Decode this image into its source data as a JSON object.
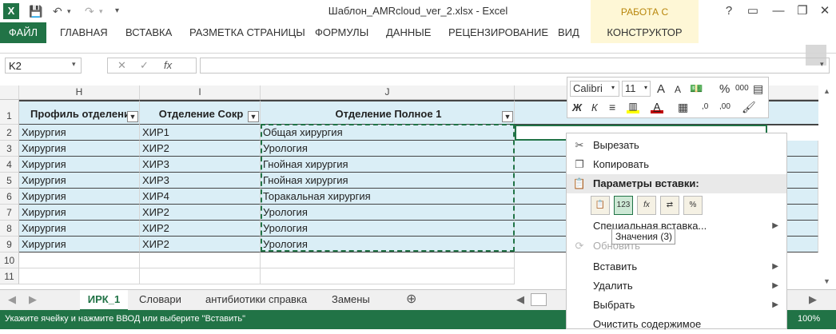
{
  "app": {
    "title": "Шаблон_AMRcloud_ver_2.xlsx - Excel",
    "context_tab_group": "РАБОТА С ТАБЛИЦАМИ",
    "accent": "#217346"
  },
  "window_buttons": [
    "?",
    "▭",
    "—",
    "❐",
    "✕"
  ],
  "ribbon_tabs": [
    "ФАЙЛ",
    "ГЛАВНАЯ",
    "ВСТАВКА",
    "РАЗМЕТКА СТРАНИЦЫ",
    "ФОРМУЛЫ",
    "ДАННЫЕ",
    "РЕЦЕНЗИРОВАНИЕ",
    "ВИД",
    "КОНСТРУКТОР"
  ],
  "formula_bar": {
    "name_box": "K2",
    "fx": "fx",
    "value": ""
  },
  "columns": [
    "H",
    "I",
    "J"
  ],
  "row_numbers": [
    "1",
    "2",
    "3",
    "4",
    "5",
    "6",
    "7",
    "8",
    "9",
    "10",
    "11"
  ],
  "table_headers": [
    "Профиль отделени",
    "Отделение Сокр",
    "Отделение Полное 1"
  ],
  "rows": [
    [
      "Хирургия",
      "ХИР1",
      "Общая хирургия"
    ],
    [
      "Хирургия",
      "ХИР2",
      "Урология"
    ],
    [
      "Хирургия",
      "ХИР3",
      "Гнойная хирургия"
    ],
    [
      "Хирургия",
      "ХИР3",
      "Гнойная хирургия"
    ],
    [
      "Хирургия",
      "ХИР4",
      "Торакальная хирургия"
    ],
    [
      "Хирургия",
      "ХИР2",
      "Урология"
    ],
    [
      "Хирургия",
      "ХИР2",
      "Урология"
    ],
    [
      "Хирургия",
      "ХИР2",
      "Урология"
    ]
  ],
  "sheet_tabs": [
    "ИРК_1",
    "Словари",
    "антибиотики справка",
    "Замены"
  ],
  "status": {
    "message": "Укажите ячейку и нажмите ВВОД или выберите \"Вставить\"",
    "zoom": "100%"
  },
  "mini_toolbar": {
    "font": "Calibri",
    "size": "11"
  },
  "context_menu": {
    "cut": "Вырезать",
    "copy": "Копировать",
    "paste_options": "Параметры вставки:",
    "paste_special": "Специальная вставка...",
    "refresh": "Обновить",
    "insert": "Вставить",
    "delete": "Удалить",
    "select": "Выбрать",
    "clear": "Очистить содержимое"
  },
  "tooltip": "Значения (3)"
}
